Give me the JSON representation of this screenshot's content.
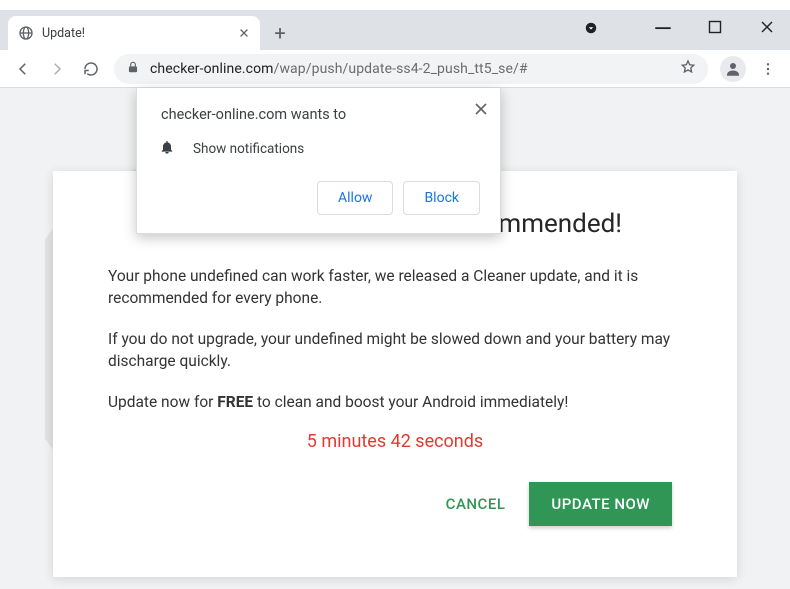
{
  "window": {
    "tab_title": "Update!",
    "url_host": "checker-online.com",
    "url_path": "/wap/push/update-ss4-2_push_tt5_se/#"
  },
  "notif": {
    "title": "checker-online.com wants to",
    "permission_label": "Show notifications",
    "allow": "Allow",
    "block": "Block"
  },
  "content": {
    "heading_suffix": "mmended!",
    "para1": "Your phone undefined can work faster, we released a Cleaner update, and it is recommended for every phone.",
    "para2": "If you do not upgrade, your undefined might be slowed down and your battery may discharge quickly.",
    "para3_pre": "Update now for ",
    "para3_bold": "FREE",
    "para3_post": " to clean and boost your Android immediately!",
    "countdown": "5 minutes 42 seconds",
    "cancel": "CANCEL",
    "update": "UPDATE NOW"
  }
}
